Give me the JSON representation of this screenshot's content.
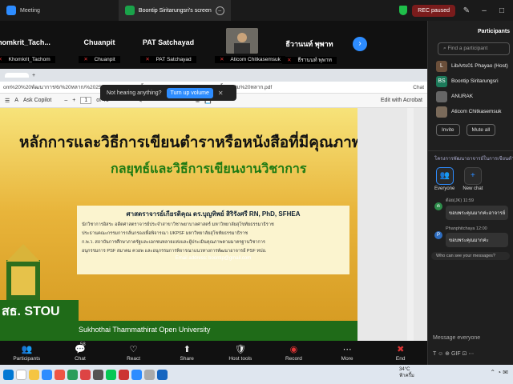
{
  "window": {
    "tabs": [
      {
        "label": "Meeting"
      },
      {
        "label": "Boontip Siritarungsri's screen"
      }
    ],
    "rec_label": "REC paused"
  },
  "participants_strip": [
    {
      "name": "homkrit_Tach...",
      "label": "Khomkrit_Tachom"
    },
    {
      "name": "Chuanpit",
      "label": "Chuanpit"
    },
    {
      "name": "PAT Satchayad",
      "label": "PAT Satchayad"
    },
    {
      "name": "",
      "label": "Aticom Chitkasemsuk"
    },
    {
      "name": "ธีวานนท์ พุพาท",
      "label": "ธีรานนท์ พุพาท"
    }
  ],
  "banner": {
    "question": "Not hearing anything?",
    "button": "Turn up volume"
  },
  "browser": {
    "tab_plus": "+",
    "url": "om%20%20พัฒนาการ/6/%20หลาก/%20256/6/%20309%20ชิ้น%20ม%20หลาก/ppt%2030%20ชิ้น%20ม%20หลาก.pdf",
    "chat_label": "Chat"
  },
  "pdf_toolbar": {
    "copilot": "Ask Copilot",
    "page": "1",
    "of": "of 40",
    "edit": "Edit with Acrobat"
  },
  "slide": {
    "title": "หลักการและวิธีการเขียนตำราหรือหนังสือที่มีคุณภาพ:",
    "subtitle": "กลยุทธ์และวิธีการเขียนงานวิชาการ",
    "speaker": "ศาสตราจารย์เกียรติคุณ ดร.บุญทิพย์ สิริรังศรี RN, PhD, SFHEA",
    "line1": "นักวิชาการอิสระ อดีตศาสตราจารย์ประจำสาขาวิชาพยาบาลศาสตร์ มหาวิทยาลัยสุโขทัยธรรมาธิราช",
    "line2": "ประธานคณะกรรมการกลั่นกรองเพื่อพิจารณา UKPSF มหาวิทยาลัยสุโขทัยธรรมาธิราช",
    "line3": "ก.พ.ว. สถาบันการศึกษาภาครัฐและเอกชนหลายแห่งและผู้ประเมินคุณภาพตามมาตรฐานวิชาการ",
    "line4": "อนุกรรมการ PSF สมาคม ควอพ และอนุกรรมการพิจารณาแนวทางการพัฒนาอาจารย์ PSF ทปอ.",
    "email": "Email address: boontip@gmail.com",
    "logo_text": "สธ. STOU",
    "footer": "Sukhothai Thammathirat Open University"
  },
  "toolbar": [
    {
      "icon": "participants-icon",
      "glyph": "👥",
      "label": "Participants",
      "badge": "58"
    },
    {
      "icon": "chat-icon",
      "glyph": "💬",
      "label": "Chat"
    },
    {
      "icon": "react-icon",
      "glyph": "♡",
      "label": "React"
    },
    {
      "icon": "share-icon",
      "glyph": "⬆",
      "label": "Share"
    },
    {
      "icon": "host-tools-icon",
      "glyph": "🛡",
      "label": "Host tools"
    },
    {
      "icon": "record-icon",
      "glyph": "◉",
      "label": "Record"
    },
    {
      "icon": "more-icon",
      "glyph": "⋯",
      "label": "More"
    },
    {
      "icon": "end-icon",
      "glyph": "✖",
      "label": "End"
    }
  ],
  "panel": {
    "title": "Participants",
    "search_placeholder": "Find a participant",
    "list": [
      {
        "initial": "L",
        "name": "LibArts01 Phayao (Host)",
        "color": "#6b4f3a"
      },
      {
        "initial": "BS",
        "name": "Boontip Siritarungsri",
        "color": "#1c7a5a"
      },
      {
        "initial": "",
        "name": "ANURAK",
        "color": "#666666"
      },
      {
        "initial": "",
        "name": "Aticom Chitkasemsuk",
        "color": "#7a6a5a"
      }
    ],
    "invite": "Invite",
    "mute_all": "Mute all",
    "chat_header": "โครงการพัฒนาอาจารย์ในการเขียนตำรา...",
    "modes": [
      {
        "label": "Everyone",
        "glyph": "👥"
      },
      {
        "label": "New chat",
        "glyph": "+"
      }
    ],
    "messages": [
      {
        "initial": "ต",
        "sender": "ต้อย(JK) 11:59",
        "text": "ขอบพระคุณมากค่ะอาจารย์",
        "color": "#2d8c4a"
      },
      {
        "initial": "P",
        "sender": "Phanphitchaya 12:00",
        "text": "ขอบพระคุณมากค่ะ",
        "color": "#2d6cbf"
      }
    ],
    "see_more": "Who can see your messages?",
    "input_placeholder": "Message everyone",
    "chat_tools": "T ☺ ⊕ GIF ⊡ ⋯"
  },
  "taskbar": {
    "temp": "34°C",
    "weather": "ฟ้าครึ้ม"
  }
}
